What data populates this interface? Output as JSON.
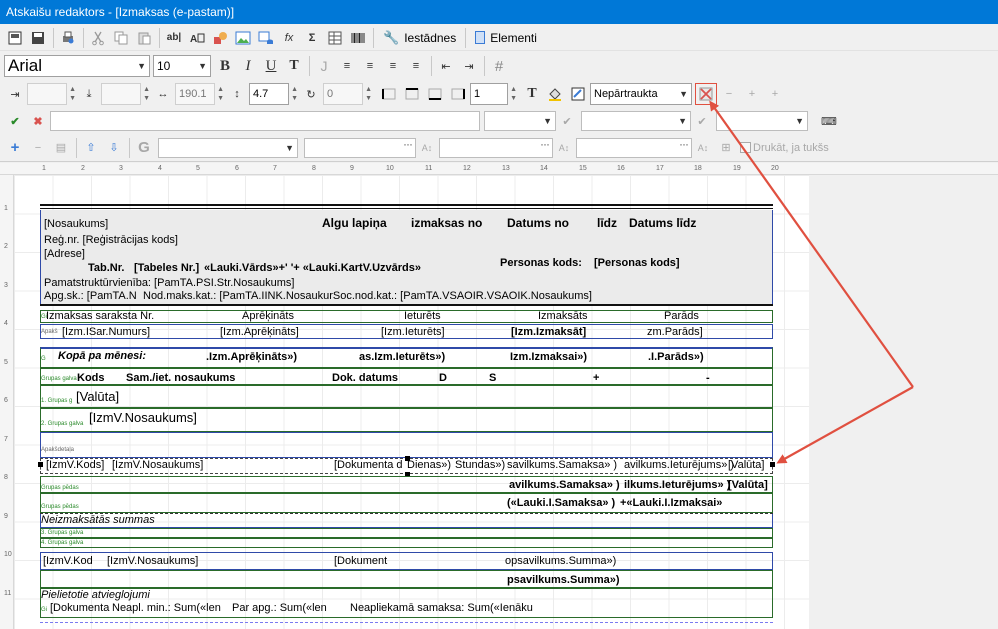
{
  "window": {
    "title": "Atskaišu redaktors - [Izmaksas (e-pastam)]"
  },
  "toolbar": {
    "settings_label": "Iestādnes",
    "elements_label": "Elementi",
    "font": "Arial",
    "size": "10"
  },
  "format": {
    "width": "190.1",
    "height": "4.7",
    "rotate": "0",
    "lines": "1",
    "border_style": "Nepārtraukta"
  },
  "fields": {
    "print_if_empty": "Drukāt, ja tukšs"
  },
  "ruler": [
    "1",
    "2",
    "3",
    "4",
    "5",
    "6",
    "7",
    "8",
    "9",
    "10",
    "11",
    "12",
    "13",
    "14",
    "15",
    "16",
    "17",
    "18",
    "19",
    "20"
  ],
  "rows": [
    "1",
    "2",
    "3",
    "4",
    "5",
    "6",
    "7",
    "8",
    "9",
    "10",
    "11"
  ],
  "report": {
    "header": {
      "nosaukums": "[Nosaukums]",
      "algu": "Algu lapiņa",
      "izmaksas_no": "izmaksas no",
      "datums_no": "Datums no",
      "lidz": "līdz",
      "datums_lidz": "Datums līdz",
      "regnr": "Reģ.nr. [Reģistrācijas kods]",
      "adrese": "[Adrese]",
      "tabnr_label": "Tab.Nr.",
      "tabnr": "[Tabeles Nr.]",
      "vards": "«Lauki.Vārds»+' '+ «Lauki.KartV.Uzvārds»",
      "perskods_label": "Personas kods:",
      "perskods": "[Personas kods]",
      "pamatstr": "Pamatstruktūrvienība:  [PamTA.PSI.Str.Nosaukums]",
      "apgsk": "Apg.sk.: [PamTA.N",
      "nodmaks": "Nod.maks.kat.: [PamTA.IINK.NosaukurSoc.nod.kat.: [PamTA.VSAOIR.VSAOIK.Nosaukums]"
    },
    "colhead": {
      "g": "Gi",
      "nr": "Izmaksas saraksta Nr.",
      "apr": "Aprēķināts",
      "iet": "Ieturēts",
      "izm": "Izmaksāts",
      "par": "Parāds"
    },
    "coldata": {
      "label": "Apakš",
      "nr": "[Izm.ISar.Numurs]",
      "apr": "[Izm.Aprēķināts]",
      "iet": "[Izm.Ieturēts]",
      "izm": "[Izm.Izmaksāt]",
      "par": "zm.Parāds]"
    },
    "month": {
      "g": "G",
      "label": "Kopā pa mēnesi:",
      "apr": ".Izm.Aprēķināts»)",
      "iet": "as.Izm.Ieturēts»)",
      "izm": "Izm.Izmaksai»)",
      "par": ".I.Parāds»)"
    },
    "grp": {
      "label": "Grupas galva",
      "kods": "Kods",
      "sam": "Sam./iet. nosaukums",
      "dok": "Dok. datums",
      "d": "D",
      "s": "S",
      "plus": "+",
      "minus": "-",
      "g1": "1. Grupas g",
      "valuta": "[Valūta]",
      "g2": "2. Grupas galva",
      "nosauk": "[IzmV.Nosaukums]",
      "apaks": "Apakšdetaļa"
    },
    "detail": {
      "kods": "[IzmV.Kods]",
      "nos": "[IzmV.Nosaukums]",
      "dok": "[Dokumenta d",
      "dienas": "Dienas»)",
      "stundas": "Stundas»)",
      "sam": "savilkums.Samaksa» )",
      "iet": "avilkums.Ieturējums» )",
      "val": "[Valūta]"
    },
    "foot1": {
      "label": "Grupas pēdas",
      "sam": "avilkums.Samaksa» )",
      "iet": "ilkums.Ieturējums» )",
      "val": "[Valūta]"
    },
    "foot2": {
      "label": "Grupas pēdas",
      "sam": "(«Lauki.I.Samaksa» )",
      "izm": "+«Lauki.I.Izmaksai»"
    },
    "neiz": {
      "label": "Neizmaksātās summas",
      "g3": "3. Grupas galva",
      "g4": "4. Grupas galva"
    },
    "summ": {
      "kods": "[IzmV.Kod",
      "nos": "[IzmV.Nosaukums]",
      "dok": "[Dokument",
      "summa": "opsavilkums.Summa»)",
      "summa2": "psavilkums.Summa»)"
    },
    "piel": {
      "label": "Pielietotie atvieglojumi",
      "g": "Gi",
      "dok": "[Dokumenta",
      "neapl": "Neapl. min.:  Sum(«len",
      "parapg": "Par apg.:  Sum(«len",
      "neapl2": "Neapliekamā samaksa:   Sum(«Ienāku"
    }
  },
  "colors": {
    "titlebar": "#0078d7",
    "band_green": "#2a6b2a",
    "band_blue": "#2f4aa8",
    "arrow": "#e05040"
  }
}
